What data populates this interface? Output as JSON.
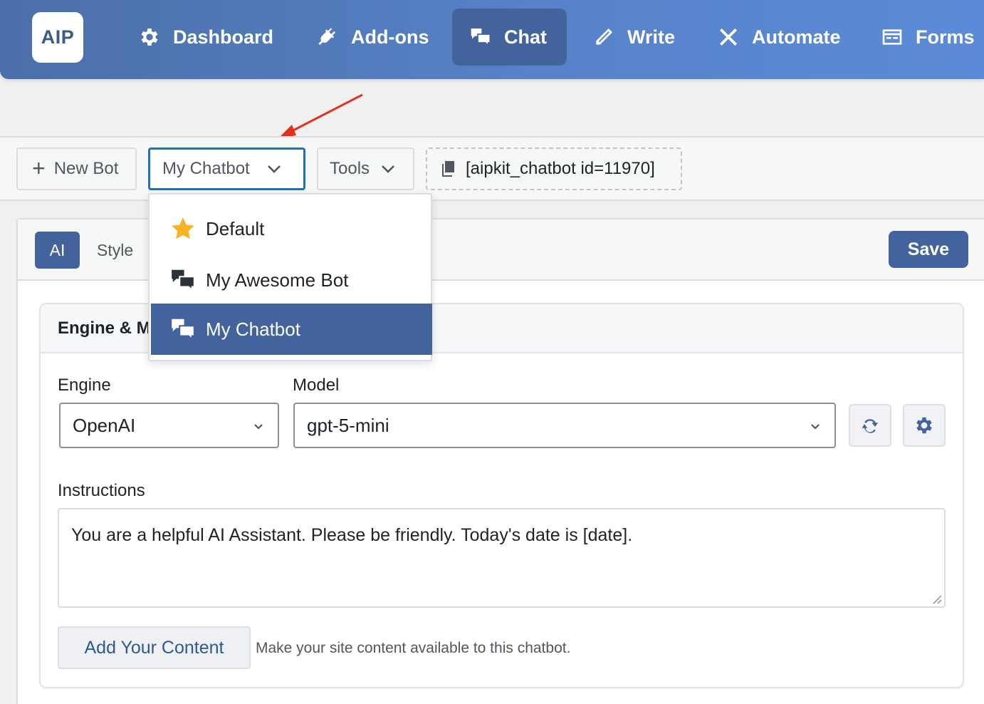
{
  "app": {
    "logo_text": "AIP"
  },
  "nav": {
    "items": [
      {
        "label": "Dashboard",
        "icon": "gear-icon"
      },
      {
        "label": "Add-ons",
        "icon": "plug-icon"
      },
      {
        "label": "Chat",
        "icon": "chat-bubbles-icon",
        "active": true
      },
      {
        "label": "Write",
        "icon": "pencil-icon"
      },
      {
        "label": "Automate",
        "icon": "tools-icon"
      },
      {
        "label": "Forms",
        "icon": "form-icon"
      }
    ]
  },
  "toolbar": {
    "new_bot_label": "New Bot",
    "selected_bot": "My Chatbot",
    "tools_label": "Tools",
    "shortcode": "[aipkit_chatbot id=11970]"
  },
  "bot_dropdown": {
    "options": [
      {
        "label": "Default",
        "icon": "star-icon"
      },
      {
        "label": "My Awesome Bot",
        "icon": "chat-bubbles-icon"
      },
      {
        "label": "My Chatbot",
        "icon": "chat-bubbles-icon",
        "selected": true
      }
    ]
  },
  "tabs": {
    "ai": "AI",
    "style": "Style"
  },
  "save_label": "Save",
  "card": {
    "title": "Engine & Model",
    "engine_label": "Engine",
    "engine_value": "OpenAI",
    "model_label": "Model",
    "model_value": "gpt-5-mini",
    "instructions_label": "Instructions",
    "instructions_value": "You are a helpful AI Assistant. Please be friendly. Today's date is [date].",
    "add_content_label": "Add Your Content",
    "add_content_hint": "Make your site content available to this chatbot."
  },
  "colors": {
    "nav_gradient_start": "#4b6fa8",
    "nav_gradient_end": "#5b8bd8",
    "primary": "#42639c",
    "focus_border": "#2271b1",
    "annotation_arrow": "#e0321c",
    "star": "#f5b325"
  }
}
